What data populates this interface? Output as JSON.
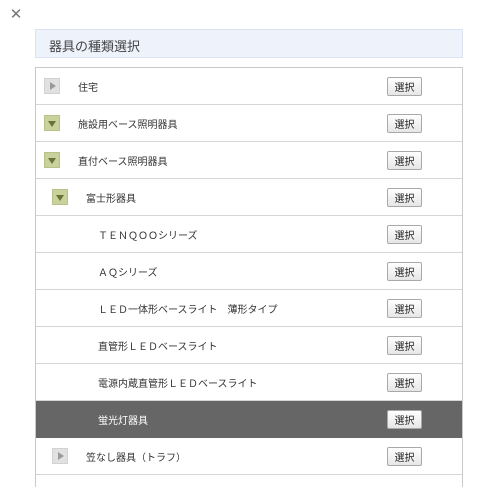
{
  "dialog": {
    "close_symbol": "✕",
    "title": "器具の種類選択",
    "select_label": "選択"
  },
  "colors": {
    "header_bg": "#eef2fb",
    "selected_row_bg": "#666666",
    "expanded_toggle": "#c9d19c",
    "collapsed_toggle": "#e1e1e1"
  },
  "tree": [
    {
      "label": "住宅",
      "level": 0,
      "toggle": "collapsed",
      "selected": false
    },
    {
      "label": "施設用ベース照明器具",
      "level": 0,
      "toggle": "expanded",
      "selected": false
    },
    {
      "label": "直付ベース照明器具",
      "level": 1,
      "toggle": "expanded",
      "selected": false
    },
    {
      "label": "富士形器具",
      "level": 2,
      "toggle": "expanded",
      "selected": false
    },
    {
      "label": "ＴＥＮＱＯＯシリーズ",
      "level": 3,
      "toggle": "none",
      "selected": false
    },
    {
      "label": "ＡＱシリーズ",
      "level": 3,
      "toggle": "none",
      "selected": false
    },
    {
      "label": "ＬＥＤ一体形ベースライト　薄形タイプ",
      "level": 3,
      "toggle": "none",
      "selected": false
    },
    {
      "label": "直管形ＬＥＤベースライト",
      "level": 3,
      "toggle": "none",
      "selected": false
    },
    {
      "label": "電源内蔵直管形ＬＥＤベースライト",
      "level": 3,
      "toggle": "none",
      "selected": false
    },
    {
      "label": "蛍光灯器具",
      "level": 3,
      "toggle": "none",
      "selected": true
    },
    {
      "label": "笠なし器具（トラフ）",
      "level": 2,
      "toggle": "collapsed",
      "selected": false
    }
  ]
}
